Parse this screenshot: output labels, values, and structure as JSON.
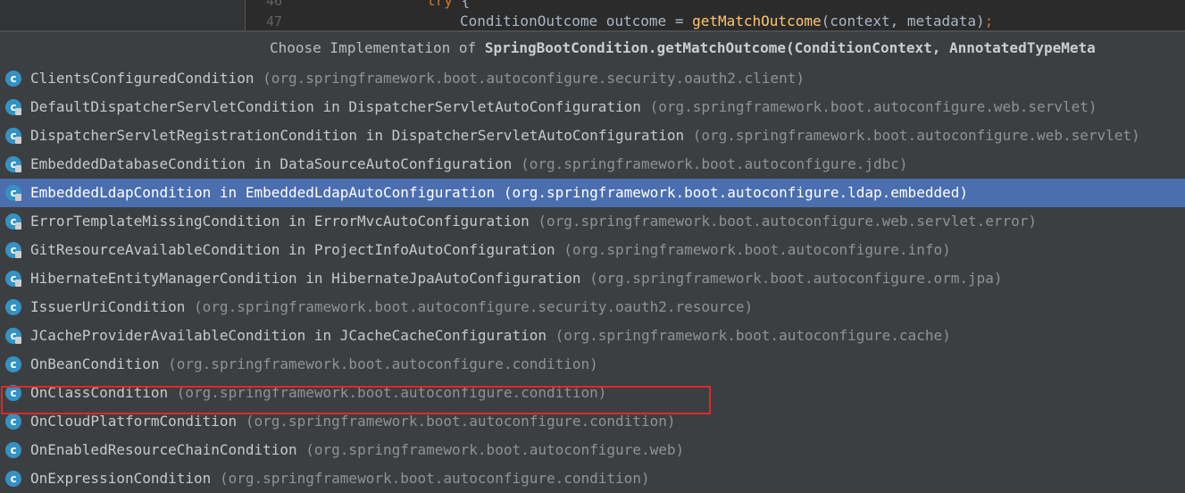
{
  "editor": {
    "lines": [
      {
        "num": "46",
        "code_keyword": "try",
        "code_rest": " {"
      },
      {
        "num": "47",
        "code_prefix": "ConditionOutcome outcome = ",
        "code_fn": "getMatchOutcome",
        "code_suffix": "(context, metadata)",
        "code_semi": ";"
      }
    ]
  },
  "popup": {
    "header_prefix": "Choose Implementation of ",
    "header_method": "SpringBootCondition.getMatchOutcome(ConditionContext, AnnotatedTypeMeta",
    "items": [
      {
        "name": "ClientsConfiguredCondition",
        "pkg": "(org.springframework.boot.autoconfigure.security.oauth2.client)",
        "icon": "class-icon",
        "locked": false
      },
      {
        "name": "DefaultDispatcherServletCondition in DispatcherServletAutoConfiguration",
        "pkg": "(org.springframework.boot.autoconfigure.web.servlet)",
        "icon": "class-icon",
        "locked": true
      },
      {
        "name": "DispatcherServletRegistrationCondition in DispatcherServletAutoConfiguration",
        "pkg": "(org.springframework.boot.autoconfigure.web.servlet)",
        "icon": "class-icon",
        "locked": true
      },
      {
        "name": "EmbeddedDatabaseCondition in DataSourceAutoConfiguration",
        "pkg": "(org.springframework.boot.autoconfigure.jdbc)",
        "icon": "class-icon",
        "locked": true
      },
      {
        "name": "EmbeddedLdapCondition in EmbeddedLdapAutoConfiguration",
        "pkg": "(org.springframework.boot.autoconfigure.ldap.embedded)",
        "icon": "class-icon",
        "locked": true,
        "selected": true
      },
      {
        "name": "ErrorTemplateMissingCondition in ErrorMvcAutoConfiguration",
        "pkg": "(org.springframework.boot.autoconfigure.web.servlet.error)",
        "icon": "class-icon",
        "locked": true
      },
      {
        "name": "GitResourceAvailableCondition in ProjectInfoAutoConfiguration",
        "pkg": "(org.springframework.boot.autoconfigure.info)",
        "icon": "class-icon",
        "locked": true
      },
      {
        "name": "HibernateEntityManagerCondition in HibernateJpaAutoConfiguration",
        "pkg": "(org.springframework.boot.autoconfigure.orm.jpa)",
        "icon": "class-icon",
        "locked": true
      },
      {
        "name": "IssuerUriCondition",
        "pkg": "(org.springframework.boot.autoconfigure.security.oauth2.resource)",
        "icon": "class-icon",
        "locked": false
      },
      {
        "name": "JCacheProviderAvailableCondition in JCacheCacheConfiguration",
        "pkg": "(org.springframework.boot.autoconfigure.cache)",
        "icon": "class-icon",
        "locked": true
      },
      {
        "name": "OnBeanCondition",
        "pkg": "(org.springframework.boot.autoconfigure.condition)",
        "icon": "class-icon",
        "locked": false,
        "highlighted": true
      },
      {
        "name": "OnClassCondition",
        "pkg": "(org.springframework.boot.autoconfigure.condition)",
        "icon": "class-icon",
        "locked": false
      },
      {
        "name": "OnCloudPlatformCondition",
        "pkg": "(org.springframework.boot.autoconfigure.condition)",
        "icon": "class-icon",
        "locked": false
      },
      {
        "name": "OnEnabledResourceChainCondition",
        "pkg": "(org.springframework.boot.autoconfigure.web)",
        "icon": "class-icon",
        "locked": false
      },
      {
        "name": "OnExpressionCondition",
        "pkg": "(org.springframework.boot.autoconfigure.condition)",
        "icon": "class-icon",
        "locked": false
      }
    ]
  },
  "colors": {
    "selection": "#4b6eaf",
    "highlight_border": "#e12828",
    "class_icon": "#3592c4"
  }
}
